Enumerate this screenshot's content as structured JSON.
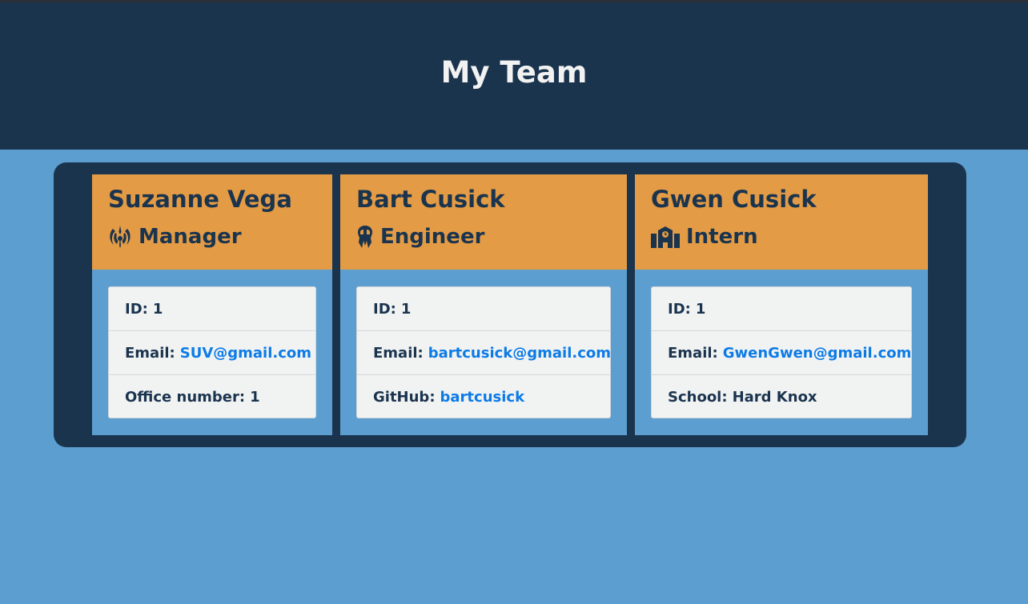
{
  "header": {
    "title": "My Team"
  },
  "colors": {
    "background": "#5c9ecf",
    "header": "#1b344e",
    "card_head": "#e39b45",
    "link": "#0d7be6"
  },
  "cards": [
    {
      "name": "Suzanne Vega",
      "role": "Manager",
      "role_icon": "jedi-order-icon",
      "id_label": "ID:",
      "id_value": "1",
      "email_label": "Email:",
      "email_value": "SUV@gmail.com",
      "extra_label": "Office number:",
      "extra_value": "1"
    },
    {
      "name": "Bart Cusick",
      "role": "Engineer",
      "role_icon": "mandalorian-icon",
      "id_label": "ID:",
      "id_value": "1",
      "email_label": "Email:",
      "email_value": "bartcusick@gmail.com",
      "extra_label": "GitHub:",
      "extra_value": "bartcusick"
    },
    {
      "name": "Gwen Cusick",
      "role": "Intern",
      "role_icon": "school-icon",
      "id_label": "ID:",
      "id_value": "1",
      "email_label": "Email:",
      "email_value": "GwenGwen@gmail.com",
      "extra_label": "School:",
      "extra_value": "Hard Knox"
    }
  ]
}
